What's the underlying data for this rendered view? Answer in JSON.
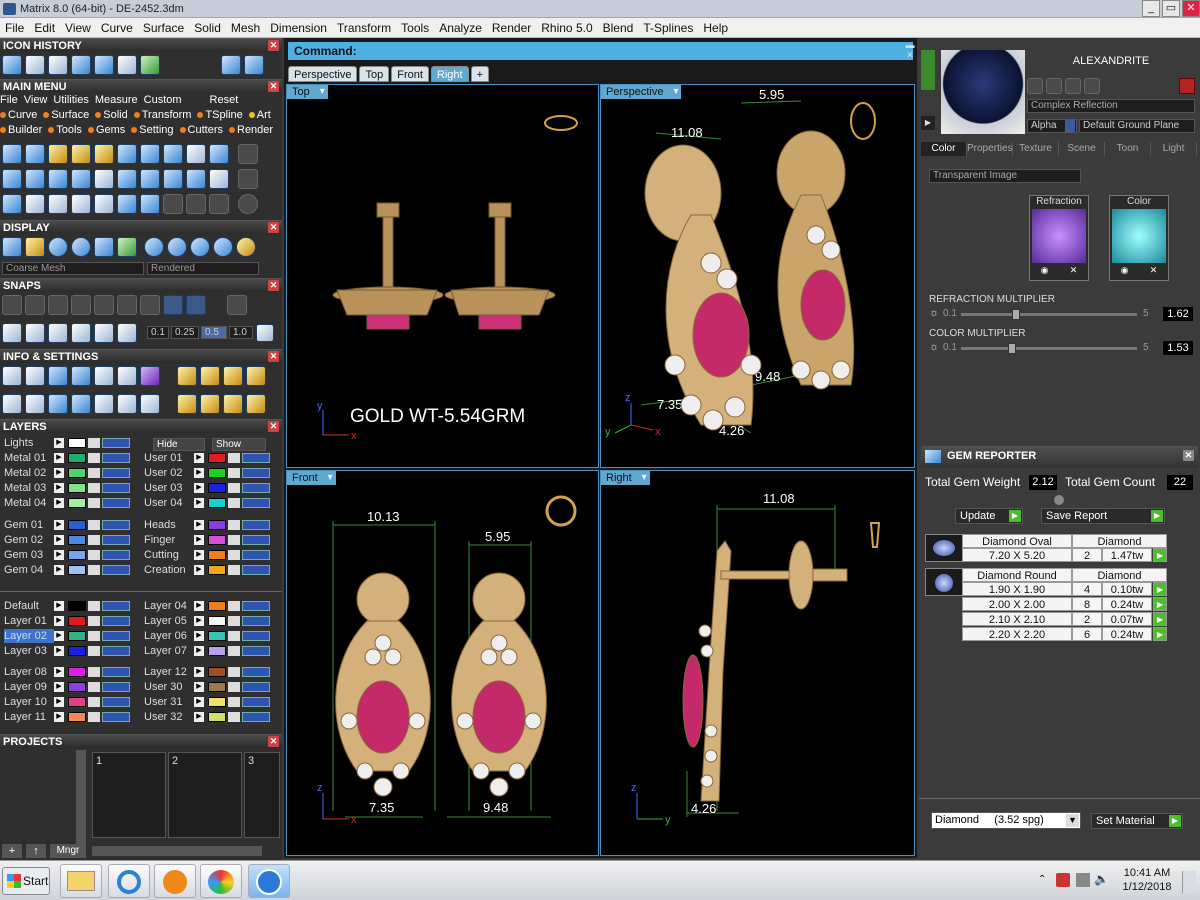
{
  "window": {
    "title": "Matrix 8.0 (64-bit) - DE-2452.3dm",
    "buttons": [
      "_",
      "▭",
      "✕"
    ]
  },
  "menu": [
    "File",
    "Edit",
    "View",
    "Curve",
    "Surface",
    "Solid",
    "Mesh",
    "Dimension",
    "Transform",
    "Tools",
    "Analyze",
    "Render",
    "Rhino 5.0",
    "Blend",
    "T-Splines",
    "Help"
  ],
  "left": {
    "icon_history": "ICON HISTORY",
    "main_menu": "MAIN MENU",
    "mm_row1": [
      "File",
      "View",
      "Utilities",
      "Measure",
      "Custom"
    ],
    "mm_reset": "Reset",
    "mm_row2": [
      "Curve",
      "Surface",
      "Solid",
      "Transform",
      "TSpline",
      "Art"
    ],
    "mm_row3": [
      "Builder",
      "Tools",
      "Gems",
      "Setting",
      "Cutters",
      "Render"
    ],
    "display": "DISPLAY",
    "display_combo1": "Coarse Mesh",
    "display_combo2": "Rendered",
    "snaps": "SNAPS",
    "snap_values": [
      "0.1",
      "0.25",
      "0.5",
      "1.0"
    ],
    "info": "INFO & SETTINGS",
    "layers": "LAYERS",
    "lights": "Lights",
    "hide": "Hide",
    "show": "Show",
    "layers_left": [
      {
        "name": "Metal 01",
        "color": "#1fae6b"
      },
      {
        "name": "Metal 02",
        "color": "#52d26a"
      },
      {
        "name": "Metal 03",
        "color": "#7fe28a"
      },
      {
        "name": "Metal 04",
        "color": "#a3eea3"
      },
      {
        "name": "Gem 01",
        "color": "#2a5fd6"
      },
      {
        "name": "Gem 02",
        "color": "#4f86e6"
      },
      {
        "name": "Gem 03",
        "color": "#76a6f0"
      },
      {
        "name": "Gem 04",
        "color": "#9ec2f6"
      },
      {
        "name": "Default",
        "color": "#000000"
      },
      {
        "name": "Layer 01",
        "color": "#e21b1b"
      },
      {
        "name": "Layer 02",
        "color": "#2fb37a"
      },
      {
        "name": "Layer 03",
        "color": "#1b21e2"
      },
      {
        "name": "Layer 08",
        "color": "#e21be2"
      },
      {
        "name": "Layer 09",
        "color": "#8b3fe0"
      },
      {
        "name": "Layer 10",
        "color": "#e23f86"
      },
      {
        "name": "Layer 11",
        "color": "#f28a5a"
      }
    ],
    "layers_right": [
      {
        "name": "User 01",
        "color": "#e21b1b"
      },
      {
        "name": "User 02",
        "color": "#1bd31b"
      },
      {
        "name": "User 03",
        "color": "#1b21e2"
      },
      {
        "name": "User 04",
        "color": "#17d0d0"
      },
      {
        "name": "Heads",
        "color": "#8b3fe0"
      },
      {
        "name": "Finger",
        "color": "#d84fd8"
      },
      {
        "name": "Cutting",
        "color": "#f07f1b"
      },
      {
        "name": "Creation",
        "color": "#f0a81b"
      },
      {
        "name": "Layer 04",
        "color": "#f07f1b"
      },
      {
        "name": "Layer 05",
        "color": "#f4f4f4"
      },
      {
        "name": "Layer 06",
        "color": "#36c4b4"
      },
      {
        "name": "Layer 07",
        "color": "#b8a2f0"
      },
      {
        "name": "Layer 12",
        "color": "#a05020"
      },
      {
        "name": "User 30",
        "color": "#a07850"
      },
      {
        "name": "User 31",
        "color": "#f0e070"
      },
      {
        "name": "User 32",
        "color": "#d0e070"
      }
    ],
    "projects": "PROJECTS",
    "project_slots": [
      "1",
      "2",
      "3"
    ],
    "mngr": "Mngr"
  },
  "main": {
    "command": "Command:",
    "tabs": [
      "Perspective",
      "Top",
      "Front",
      "Right",
      "+"
    ],
    "vp_top": "Top",
    "vp_persp": "Perspective",
    "vp_front": "Front",
    "vp_right": "Right",
    "gold_weight": "GOLD WT-5.54GRM",
    "dims": {
      "a": "5.95",
      "b": "11.08",
      "c": "7.35",
      "d": "4.26",
      "e": "9.48",
      "f": "10.13",
      "g": "5.95",
      "h": "7.35",
      "i": "9.48",
      "j": "11.08",
      "k": "4.26"
    },
    "axes": {
      "x": "x",
      "y": "y",
      "z": "z"
    }
  },
  "right": {
    "material_name": "ALEXANDRITE",
    "combo1": "Complex Reflection",
    "alpha": "Alpha",
    "ground": "Default Ground Plane",
    "tabs": [
      "Color",
      "Properties",
      "Texture",
      "Scene",
      "Toon",
      "Light"
    ],
    "transparent": "Transparent Image",
    "refraction": "Refraction",
    "color": "Color",
    "refr_mult": "REFRACTION MULTIPLIER",
    "refr_min": "0.1",
    "refr_max": "5",
    "refr_val": "1.62",
    "refr_level": 0.31,
    "color_mult": "COLOR MULTIPLIER",
    "col_min": "0.1",
    "col_max": "5",
    "col_val": "1.53",
    "col_level": 0.29,
    "gem_reporter": "GEM REPORTER",
    "total_weight_label": "Total Gem Weight",
    "total_weight": "2.12",
    "total_count_label": "Total Gem Count",
    "total_count": "22",
    "update": "Update",
    "save_report": "Save Report",
    "oval": {
      "head": "Diamond Oval",
      "type": "Diamond",
      "rows": [
        {
          "size": "7.20 X 5.20",
          "count": "2",
          "tw": "1.47tw"
        }
      ]
    },
    "round": {
      "head": "Diamond Round",
      "type": "Diamond",
      "rows": [
        {
          "size": "1.90 X 1.90",
          "count": "4",
          "tw": "0.10tw"
        },
        {
          "size": "2.00 X 2.00",
          "count": "8",
          "tw": "0.24tw"
        },
        {
          "size": "2.10 X 2.10",
          "count": "2",
          "tw": "0.07tw"
        },
        {
          "size": "2.20 X 2.20",
          "count": "6",
          "tw": "0.24tw"
        }
      ]
    },
    "material_select": "Diamond     (3.52 spg)",
    "set_material": "Set Material"
  },
  "taskbar": {
    "start": "Start",
    "time": "10:41 AM",
    "date": "1/12/2018"
  }
}
